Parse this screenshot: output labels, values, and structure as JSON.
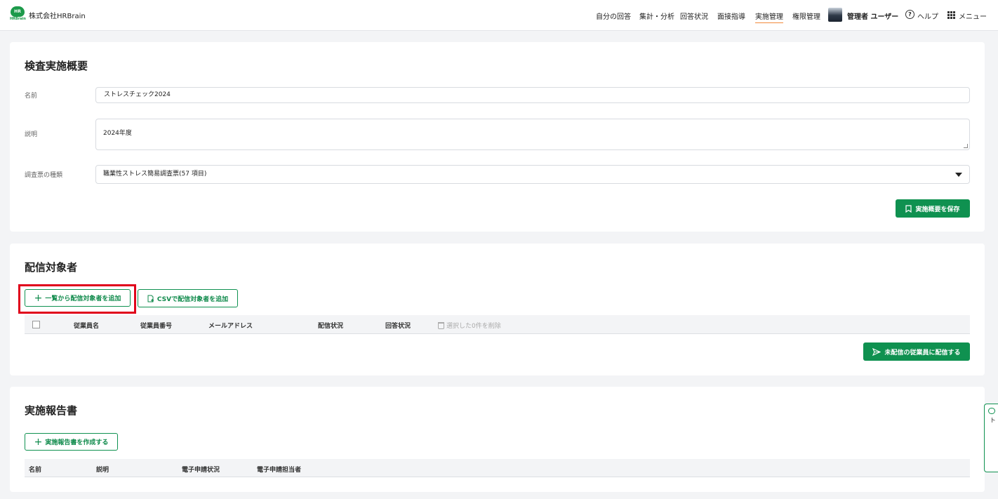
{
  "header": {
    "logo_text": "HR",
    "logo_sub": "HRBrain",
    "company": "株式会社HRBrain",
    "nav": [
      {
        "label": "自分の回答"
      },
      {
        "label": "集計・分析"
      },
      {
        "label": "回答状況"
      },
      {
        "label": "面接指導"
      },
      {
        "label": "実施管理",
        "active": true
      },
      {
        "label": "権限管理"
      }
    ],
    "user": "管理者 ユーザー",
    "help": "ヘルプ",
    "menu": "メニュー"
  },
  "overview": {
    "title": "検査実施概要",
    "name_label": "名前",
    "name_value": "ストレスチェック2024",
    "desc_label": "説明",
    "desc_value": "2024年度",
    "type_label": "調査票の種類",
    "type_value": "職業性ストレス簡易調査票(57 項目)",
    "save_button": "実施概要を保存"
  },
  "targets": {
    "title": "配信対象者",
    "add_from_list": "一覧から配信対象者を追加",
    "add_csv": "CSVで配信対象者を追加",
    "columns": [
      "従業員名",
      "従業員番号",
      "メールアドレス",
      "配信状況",
      "回答状況"
    ],
    "delete_selected": "選択した0件を削除",
    "send_button": "未配信の従業員に配信する"
  },
  "reports": {
    "title": "実施報告書",
    "create_button": "実施報告書を作成する",
    "columns": [
      "名前",
      "説明",
      "電子申請状況",
      "電子申請担当者"
    ]
  },
  "chat_support": "チャットサポート",
  "colors": {
    "primary": "#0f9150",
    "highlight": "#e0001b",
    "active_nav_underline": "#f28a3c"
  }
}
